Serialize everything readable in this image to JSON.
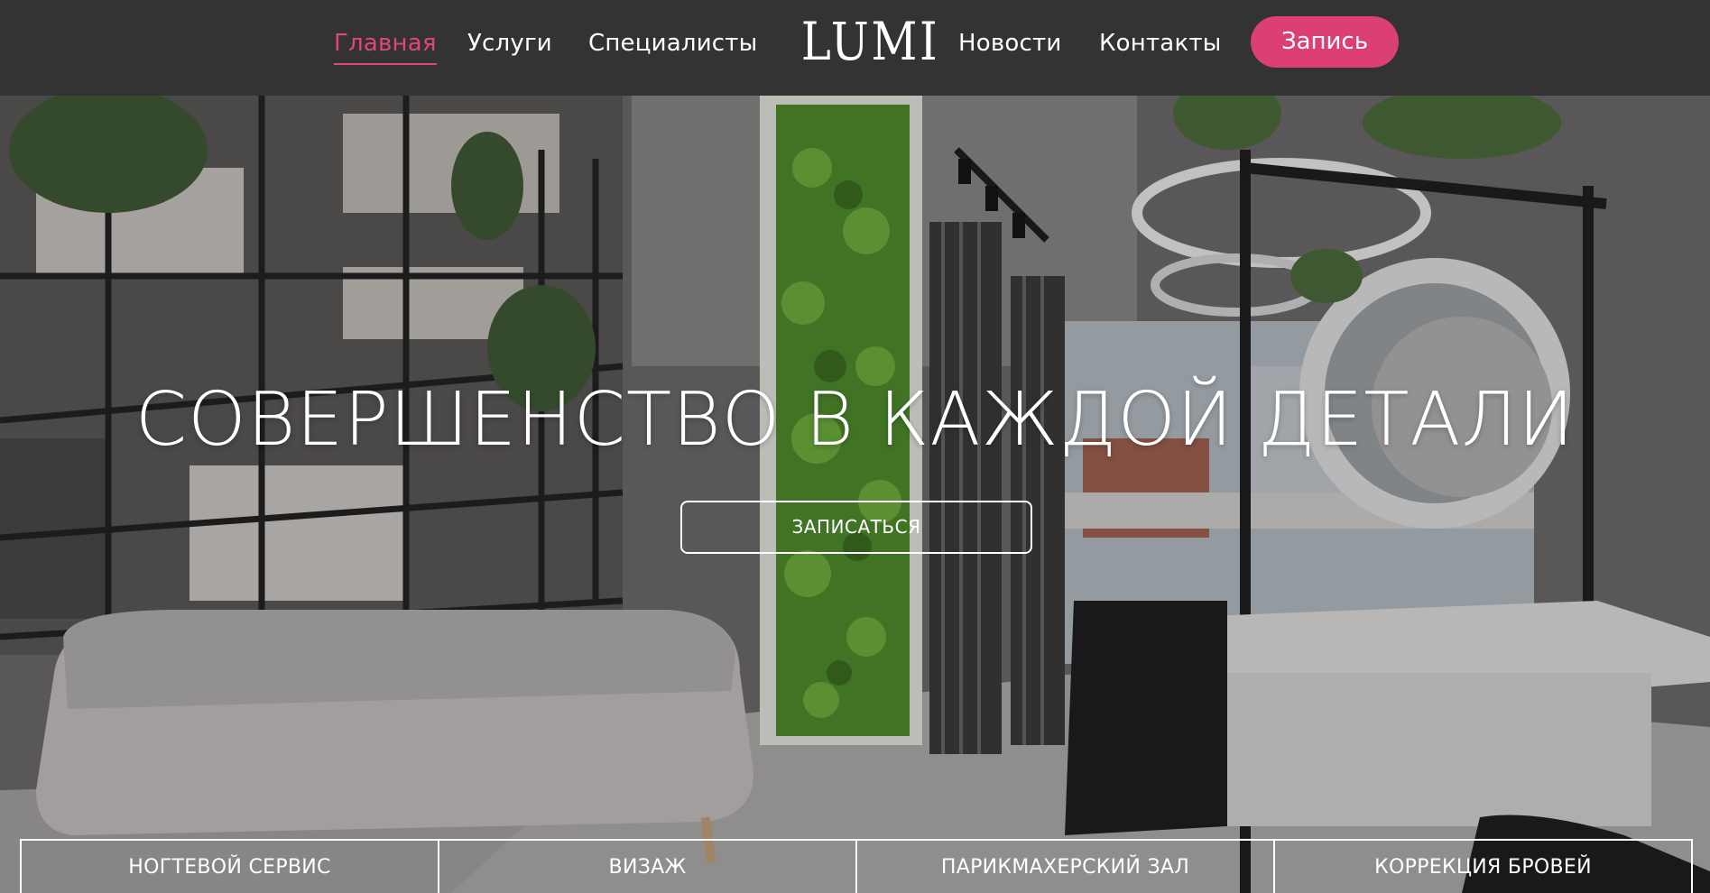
{
  "header": {
    "nav_left": [
      "Главная",
      "Услуги",
      "Специалисты"
    ],
    "logo": "LUMI",
    "nav_right": [
      "Новости",
      "Контакты"
    ],
    "book_button": "Запись",
    "accent_color": "#dc3f72"
  },
  "hero": {
    "title": "СОВЕРШЕНСТВО В КАЖДОЙ ДЕТАЛИ",
    "cta_label": "ЗАПИСАТЬСЯ"
  },
  "services": [
    "НОГТЕВОЙ СЕРВИС",
    "ВИЗАЖ",
    "ПАРИКМАХЕРСКИЙ ЗАЛ",
    "КОРРЕКЦИЯ БРОВЕЙ"
  ]
}
